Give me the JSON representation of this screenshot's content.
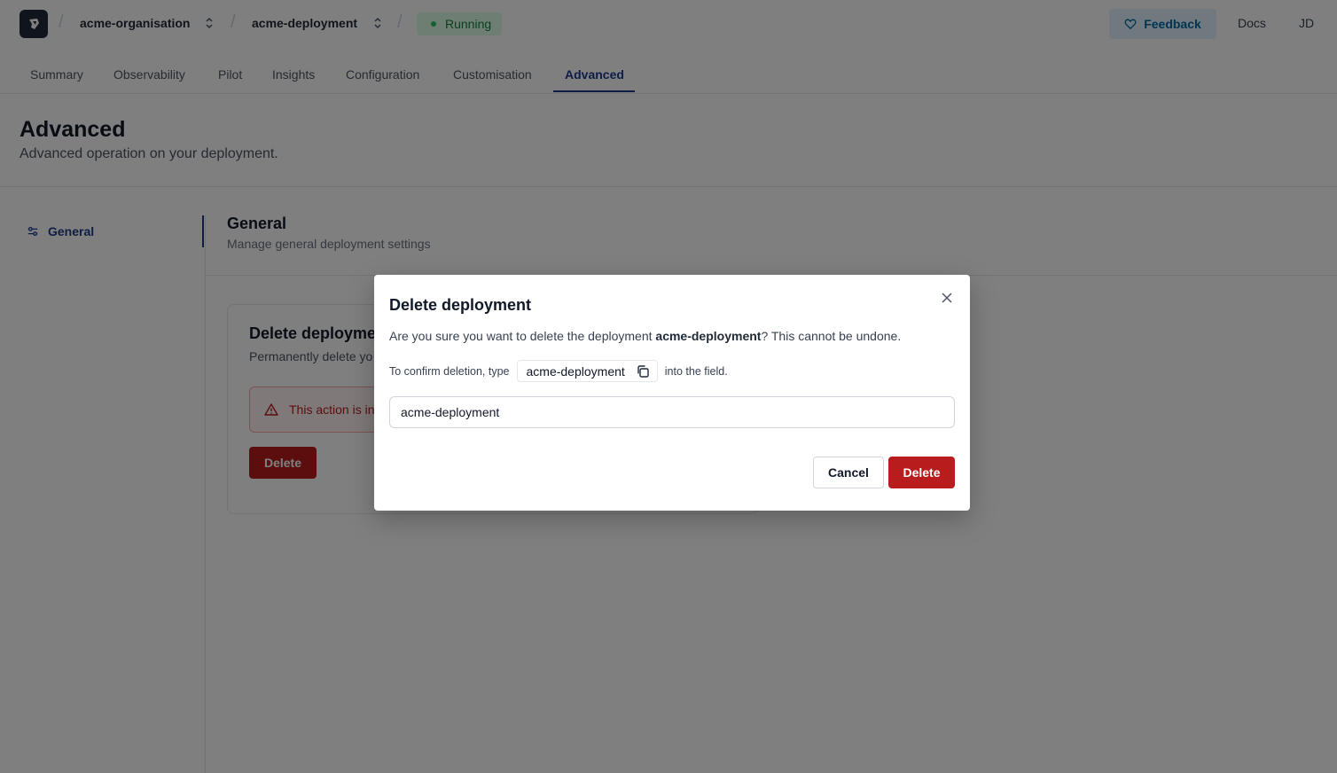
{
  "breadcrumb": {
    "organisation": "acme-organisation",
    "deployment": "acme-deployment",
    "status": "Running"
  },
  "header_actions": {
    "feedback_label": "Feedback",
    "docs_label": "Docs",
    "user_initials": "JD"
  },
  "tabs": [
    {
      "label": "Summary",
      "active": false
    },
    {
      "label": "Observability",
      "active": false
    },
    {
      "label": "Pilot",
      "active": false
    },
    {
      "label": "Insights",
      "active": false
    },
    {
      "label": "Configuration",
      "active": false
    },
    {
      "label": "Customisation",
      "active": false
    },
    {
      "label": "Advanced",
      "active": true
    }
  ],
  "page": {
    "title": "Advanced",
    "subtitle": "Advanced operation on your deployment."
  },
  "sidebar": {
    "items": [
      {
        "label": "General",
        "icon": "sliders-icon",
        "active": true
      }
    ]
  },
  "section": {
    "title": "General",
    "subtitle": "Manage general deployment settings"
  },
  "danger_card": {
    "title": "Delete deployment",
    "description": "Permanently delete yo",
    "alert_text": "This action is in",
    "delete_label": "Delete"
  },
  "modal": {
    "title": "Delete deployment",
    "question_prefix": "Are you sure you want to delete the deployment ",
    "question_name": "acme-deployment",
    "question_suffix": "? This cannot be undone.",
    "confirm_prefix": "To confirm deletion, type",
    "confirm_name": "acme-deployment",
    "confirm_suffix": "into the field.",
    "input_value": "acme-deployment",
    "cancel_label": "Cancel",
    "delete_label": "Delete"
  },
  "colors": {
    "accent": "#1e3a8a",
    "danger": "#b91c1c",
    "status_green": "#15803d"
  }
}
